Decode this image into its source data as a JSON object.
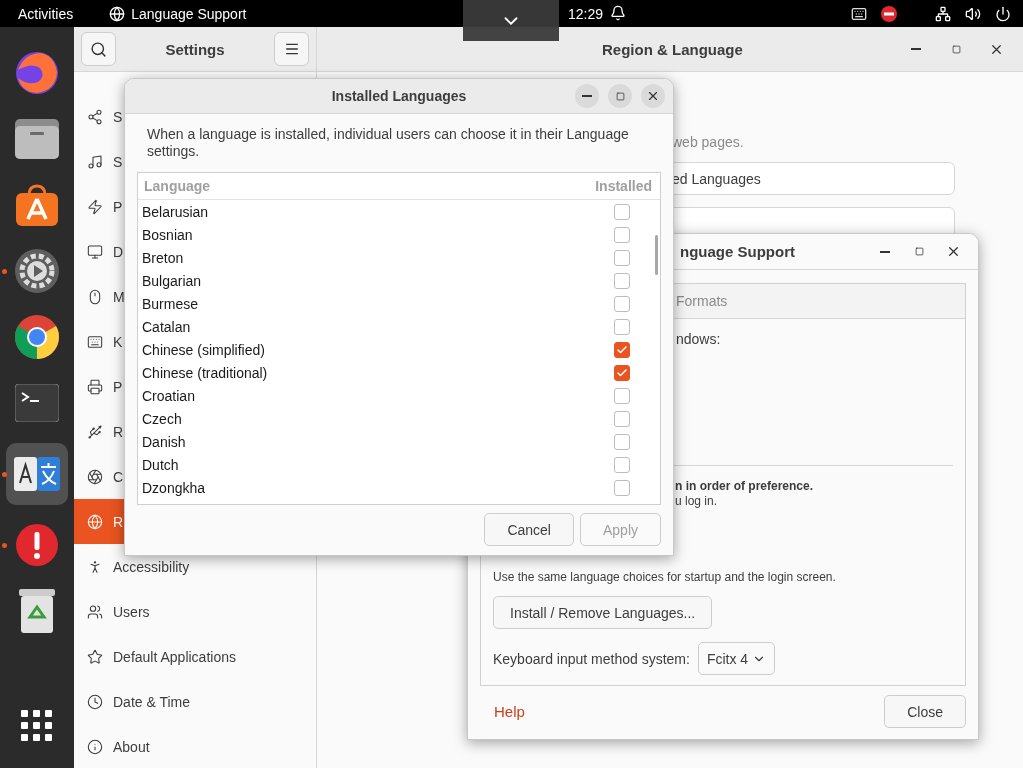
{
  "top_bar": {
    "activities": "Activities",
    "app_menu": "Language Support",
    "clock": "12:29"
  },
  "dock": [
    {
      "kind": "browser",
      "running": false,
      "selected": false
    },
    {
      "kind": "files",
      "running": false,
      "selected": false
    },
    {
      "kind": "store",
      "running": false,
      "selected": false
    },
    {
      "kind": "settings",
      "running": true,
      "selected": false
    },
    {
      "kind": "chrome",
      "running": false,
      "selected": false
    },
    {
      "kind": "terminal",
      "running": false,
      "selected": false
    },
    {
      "kind": "language",
      "running": true,
      "selected": true
    },
    {
      "kind": "alert",
      "running": true,
      "selected": false
    },
    {
      "kind": "trash",
      "running": false,
      "selected": false
    },
    {
      "kind": "apps",
      "running": false,
      "selected": false
    }
  ],
  "settings": {
    "title": "Settings",
    "panel_title": "Region & Language",
    "sidebar": [
      {
        "label": "S",
        "selected": false
      },
      {
        "label": "S",
        "selected": false
      },
      {
        "label": "P",
        "selected": false
      },
      {
        "label": "D",
        "selected": false
      },
      {
        "label": "M",
        "selected": false
      },
      {
        "label": "K",
        "selected": false
      },
      {
        "label": "P",
        "selected": false
      },
      {
        "label": "R",
        "selected": false
      },
      {
        "label": "C",
        "selected": false
      },
      {
        "label": "R",
        "selected": true
      },
      {
        "label": "Accessibility",
        "selected": false
      },
      {
        "label": "Users",
        "selected": false
      },
      {
        "label": "Default Applications",
        "selected": false
      },
      {
        "label": "Date & Time",
        "selected": false
      },
      {
        "label": "About",
        "selected": false
      }
    ],
    "hint": "web pages.",
    "manage_button": "ed Languages"
  },
  "language_support": {
    "title": "nguage Support",
    "tabs": [
      {
        "label": "Formats",
        "selected": false
      }
    ],
    "heading": "ndows:",
    "preference": "n in order of preference.",
    "login_note": "u log in.",
    "same_choices": "Use the same language choices for startup and the login screen.",
    "install_button": "Install / Remove Languages...",
    "im_label": "Keyboard input method system:",
    "im_value": "Fcitx 4",
    "help": "Help",
    "close": "Close"
  },
  "installed_languages": {
    "title": "Installed Languages",
    "description": "When a language is installed, individual users can choose it in their Language settings.",
    "columns": [
      "Language",
      "Installed"
    ],
    "rows": [
      {
        "name": "Belarusian",
        "checked": false
      },
      {
        "name": "Bosnian",
        "checked": false
      },
      {
        "name": "Breton",
        "checked": false
      },
      {
        "name": "Bulgarian",
        "checked": false
      },
      {
        "name": "Burmese",
        "checked": false
      },
      {
        "name": "Catalan",
        "checked": false
      },
      {
        "name": "Chinese (simplified)",
        "checked": true
      },
      {
        "name": "Chinese (traditional)",
        "checked": true
      },
      {
        "name": "Croatian",
        "checked": false
      },
      {
        "name": "Czech",
        "checked": false
      },
      {
        "name": "Danish",
        "checked": false
      },
      {
        "name": "Dutch",
        "checked": false
      },
      {
        "name": "Dzongkha",
        "checked": false
      }
    ],
    "buttons": [
      {
        "label": "Cancel",
        "disabled": false
      },
      {
        "label": "Apply",
        "disabled": true
      }
    ]
  }
}
